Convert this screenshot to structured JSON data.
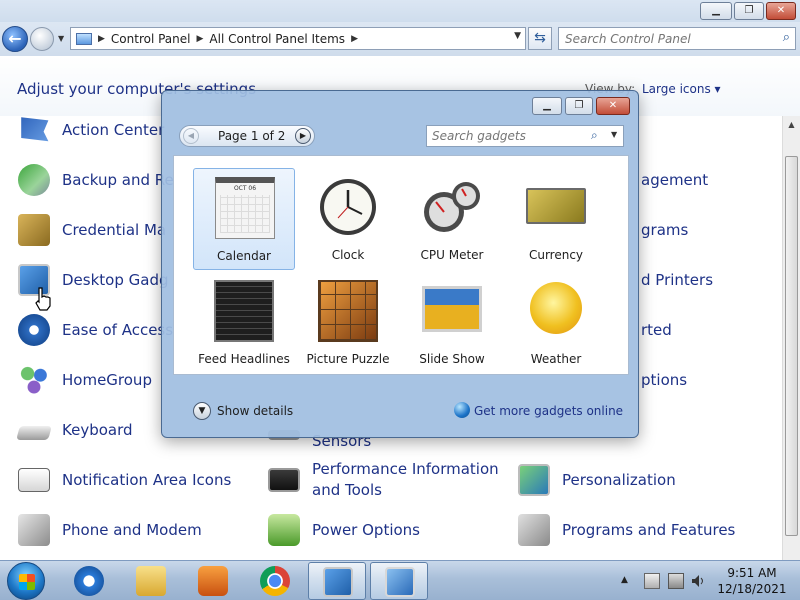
{
  "window": {
    "controls": {
      "minimize": "▁",
      "maximize": "❐",
      "close": "✕"
    }
  },
  "address_bar": {
    "crumbs": [
      "Control Panel",
      "All Control Panel Items"
    ],
    "search_placeholder": "Search Control Panel"
  },
  "header": {
    "title": "Adjust your computer's settings",
    "view_by_label": "View by:",
    "view_by_value": "Large icons ▾"
  },
  "items": {
    "col1": [
      "Action Center",
      "Backup and Restore",
      "Credential Manager",
      "Desktop Gadgets",
      "Ease of Access Center",
      "HomeGroup",
      "Keyboard",
      "Notification Area Icons",
      "Phone and Modem"
    ],
    "col2": [
      "Sensors",
      "Performance Information and Tools",
      "Power Options"
    ],
    "col3": [
      "Color Management",
      "Default Programs",
      "Devices and Printers",
      "Getting Started",
      "Internet Options",
      "Personalization",
      "Programs and Features"
    ]
  },
  "items_visible": {
    "col1": [
      "Action Center",
      "Backup and Re",
      "Credential Ma",
      "Desktop Gadg",
      "Ease of Access",
      "HomeGroup",
      "Keyboard",
      "Notification Area Icons",
      "Phone and Modem"
    ],
    "col2_sensors": "Sensors",
    "col2_perf_line1": "Performance Information",
    "col2_perf_line2": "and Tools",
    "col2_power": "Power Options",
    "col3": [
      "agement",
      "grams",
      "d Printers",
      "rted",
      "ptions",
      "Personalization",
      "Programs and Features"
    ]
  },
  "gadgets_dialog": {
    "page_label": "Page 1 of 2",
    "search_placeholder": "Search gadgets",
    "gadgets": [
      "Calendar",
      "Clock",
      "CPU Meter",
      "Currency",
      "Feed Headlines",
      "Picture Puzzle",
      "Slide Show",
      "Weather"
    ],
    "calendar_month": "OCT 06",
    "show_details": "Show details",
    "get_more": "Get more gadgets online"
  },
  "taskbar": {
    "time": "9:51 AM",
    "date": "12/18/2021"
  },
  "colors": {
    "link_blue": "#1e3287",
    "taskbar_top": "#c9d8ea",
    "dialog_glass": "#a0bee1"
  }
}
